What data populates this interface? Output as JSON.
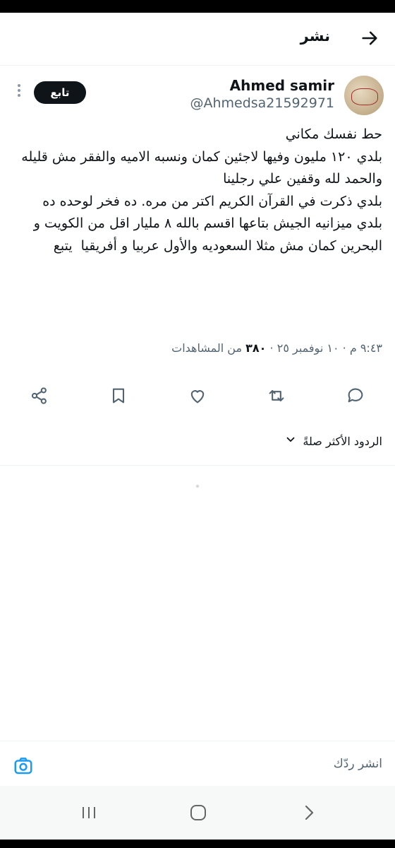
{
  "header": {
    "title": "نشر",
    "back_icon": "arrow-right-icon"
  },
  "tweet": {
    "author_name": "Ahmed samir",
    "author_handle": "@Ahmedsa21592971",
    "follow_label": "تابع",
    "text": "حط نفسك مكاني\nبلدي ١٢٠ مليون وفيها لاجئين كمان ونسبه الاميه والفقر مش قليله والحمد لله وقفين علي رجلينا\nبلدي ذكرت في القرآن الكريم اكتر من مره. ده فخر لوحده ده\nبلدي ميزانيه الجيش بتاعها اقسم بالله ٨ مليار اقل من الكويت و البحرين كمان مش مثلا السعوديه والأول عربيا و أفريقيا  يتبع",
    "time": "٩:٤٣ م",
    "date": "١٠ نوفمبر ٢٥",
    "separator": "·",
    "views_count": "٣٨٠",
    "views_label": "من المشاهدات"
  },
  "actions": {
    "reply_icon": "reply-icon",
    "retweet_icon": "retweet-icon",
    "like_icon": "heart-icon",
    "bookmark_icon": "bookmark-icon",
    "share_icon": "share-icon"
  },
  "replies": {
    "sort_label": "الردود الأكثر صلةً"
  },
  "reply_bar": {
    "placeholder": "انشر ردّك"
  },
  "colors": {
    "text": "#0f1419",
    "secondary": "#536471",
    "divider": "#eff3f4"
  }
}
